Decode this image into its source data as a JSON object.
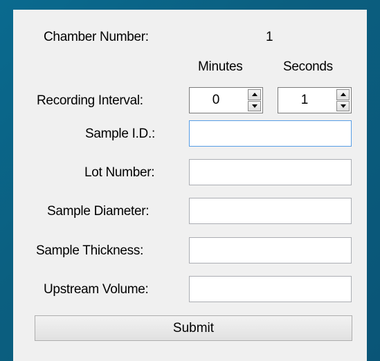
{
  "form": {
    "chamber_label": "Chamber Number:",
    "chamber_value": "1",
    "minutes_header": "Minutes",
    "seconds_header": "Seconds",
    "interval_label": "Recording Interval:",
    "minutes_value": "0",
    "seconds_value": "1",
    "sample_id_label": "Sample I.D.:",
    "lot_number_label": "Lot Number:",
    "sample_diameter_label": "Sample Diameter:",
    "sample_thickness_label": "Sample Thickness:",
    "upstream_volume_label": "Upstream Volume:",
    "sample_id_value": "",
    "lot_number_value": "",
    "sample_diameter_value": "",
    "sample_thickness_value": "",
    "upstream_volume_value": "",
    "submit_label": "Submit"
  },
  "colors": {
    "background": "#0b6285",
    "panel": "#f0f0f0",
    "focus_border": "#569de5"
  }
}
